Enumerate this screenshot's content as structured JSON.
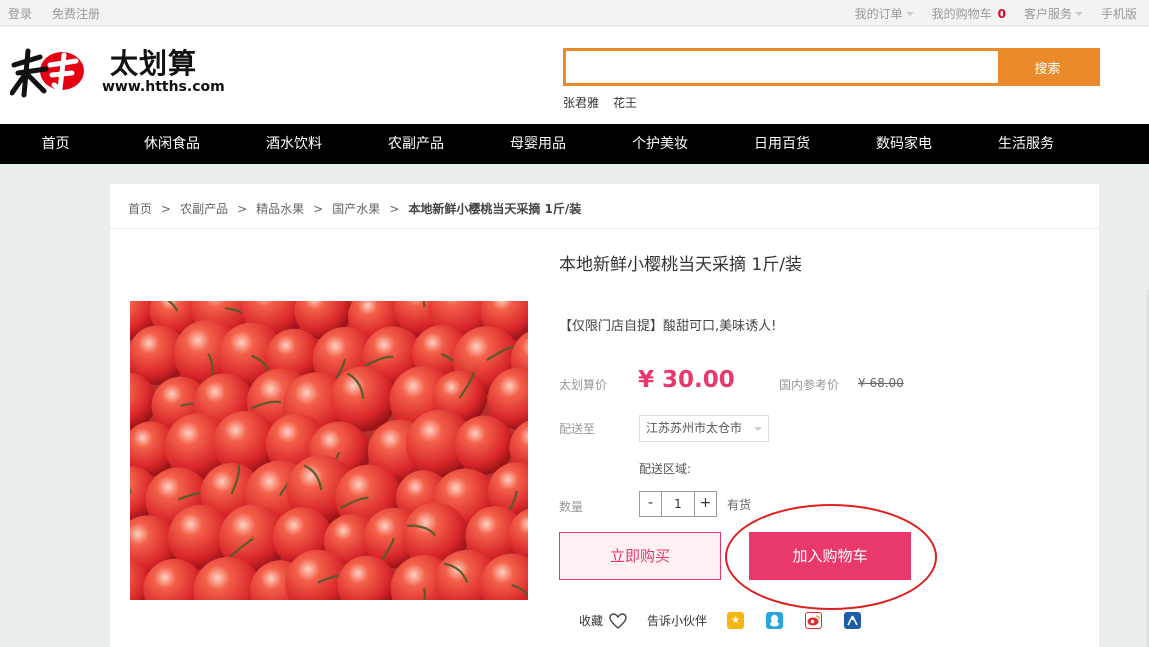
{
  "topbar": {
    "login": "登录",
    "register": "免费注册",
    "my_orders": "我的订单",
    "my_cart": "我的购物车",
    "cart_count": "0",
    "customer_service": "客户服务",
    "mobile": "手机版"
  },
  "header": {
    "site_name": "太划算",
    "site_url": "www.htths.com",
    "search_button": "搜索",
    "search_value": "",
    "hot_words": [
      "张君雅",
      "花王"
    ]
  },
  "nav": {
    "items": [
      "首页",
      "休闲食品",
      "酒水饮料",
      "农副产品",
      "母婴用品",
      "个护美妆",
      "日用百货",
      "数码家电",
      "生活服务"
    ]
  },
  "breadcrumb": {
    "items": [
      "首页",
      "农副产品",
      "精品水果",
      "国产水果"
    ],
    "current": "本地新鲜小樱桃当天采摘 1斤/装",
    "separator": ">"
  },
  "product": {
    "title": "本地新鲜小樱桃当天采摘 1斤/装",
    "subtitle": "【仅限门店自提】酸甜可口,美味诱人!",
    "price_label": "太划算价",
    "price": "¥ 30.00",
    "ref_price_label": "国内参考价",
    "ref_price": "¥ 68.00",
    "delivery_label": "配送至",
    "delivery_region": "江苏苏州市太仓市",
    "delivery_area_label": "配送区域:",
    "quantity_label": "数量",
    "quantity_minus": "-",
    "quantity": "1",
    "quantity_plus": "+",
    "stock": "有货",
    "buy_now": "立即购买",
    "add_to_cart": "加入购物车",
    "favorite": "收藏",
    "share_label": "告诉小伙伴"
  },
  "colors": {
    "accent_orange": "#ea8a2b",
    "accent_pink": "#e8396a",
    "nav_bg": "#000000",
    "highlight_ellipse": "#e02020"
  }
}
